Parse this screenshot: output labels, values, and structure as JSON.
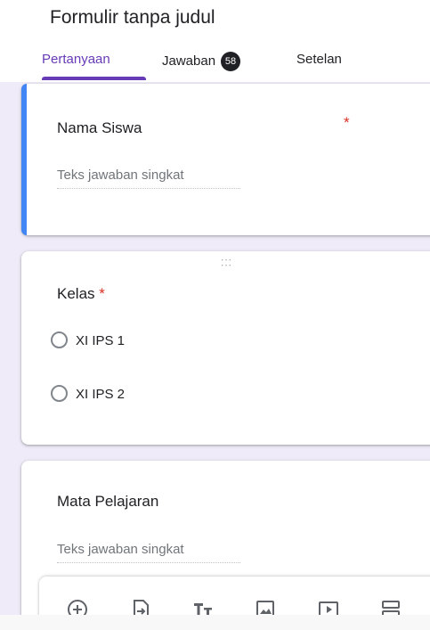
{
  "header": {
    "form_title": "Formulir tanpa judul",
    "tabs": [
      {
        "label": "Pertanyaan",
        "active": true
      },
      {
        "label": "Jawaban",
        "badge": "58"
      },
      {
        "label": "Setelan"
      }
    ]
  },
  "questions": [
    {
      "title": "Nama Siswa",
      "required_mark": "*",
      "answer_placeholder": "Teks jawaban singkat"
    },
    {
      "title": "Kelas",
      "required_mark": "*",
      "options": [
        "XI IPS 1",
        "XI IPS 2"
      ]
    },
    {
      "title": "Mata Pelajaran",
      "answer_placeholder": "Teks jawaban singkat"
    }
  ],
  "toolbar": {
    "icons": [
      "add-question-icon",
      "import-questions-icon",
      "add-title-icon",
      "add-image-icon",
      "add-video-icon",
      "add-section-icon"
    ]
  },
  "colors": {
    "accent": "#673ab7",
    "selected_bar": "#4285f4",
    "required": "#d93025",
    "canvas": "#f0ebf8"
  }
}
